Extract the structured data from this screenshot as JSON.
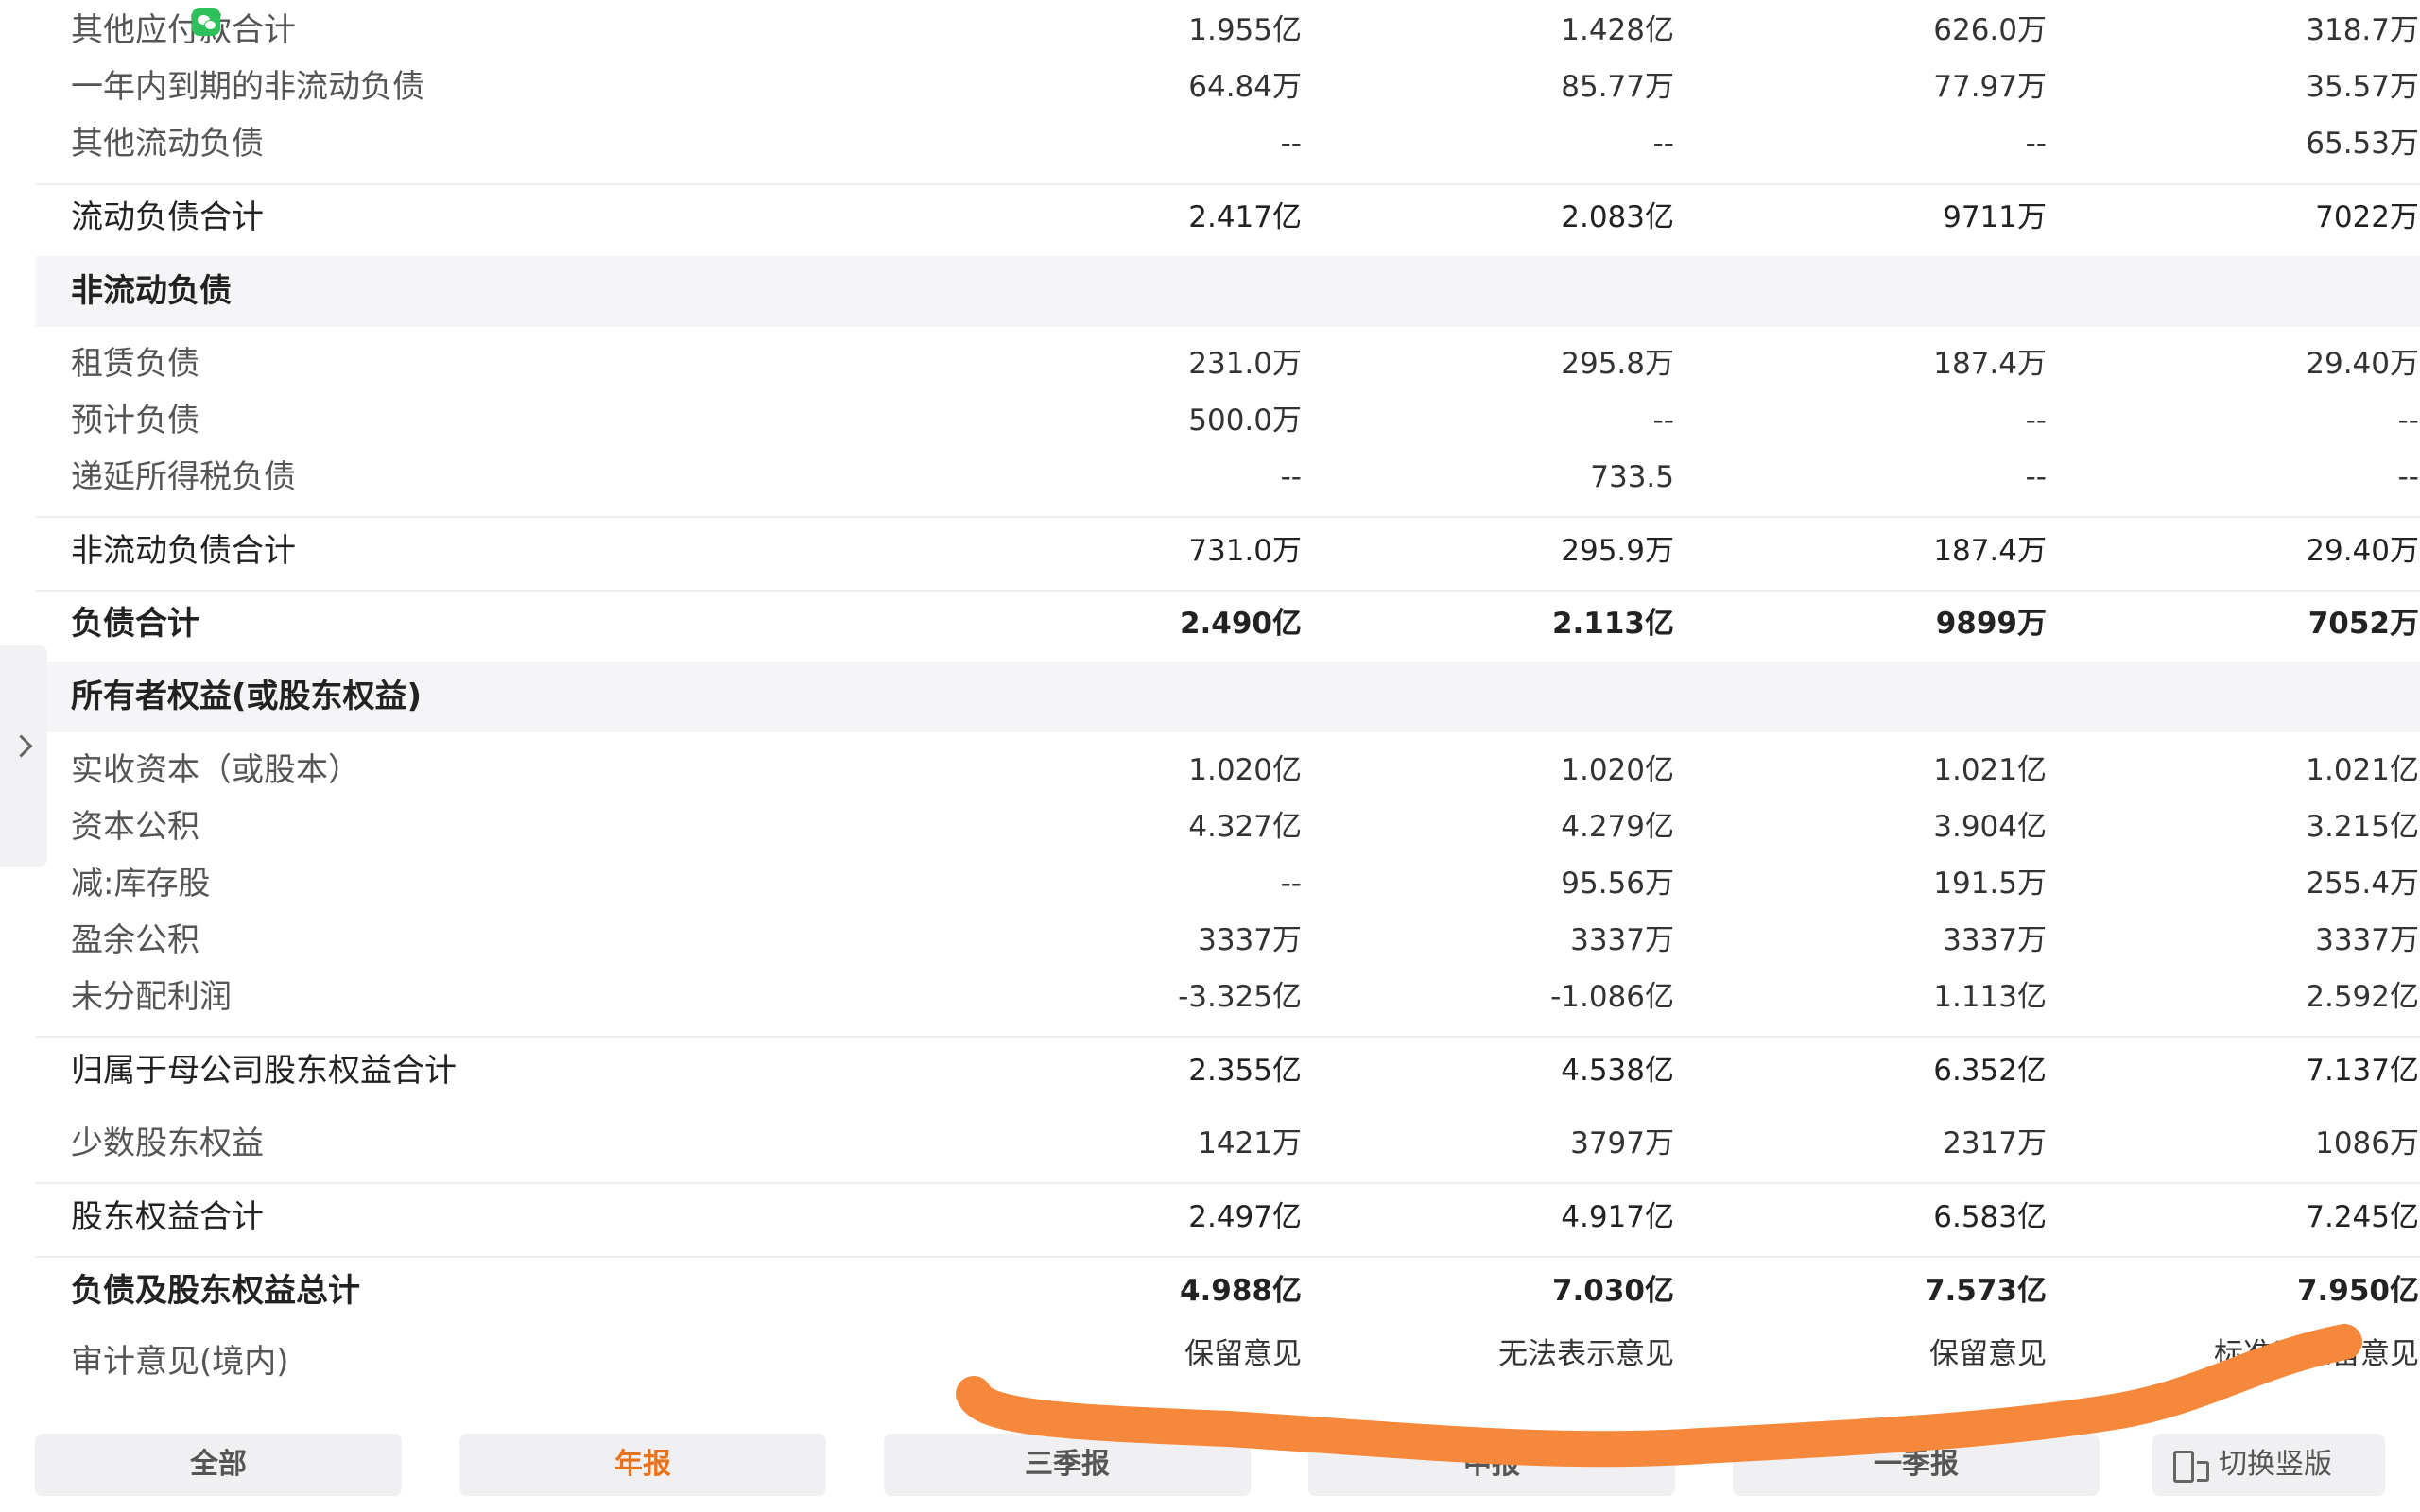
{
  "rows": {
    "other_payables": {
      "label": "其他应付款合计",
      "v": [
        "1.955亿",
        "1.428亿",
        "626.0万",
        "318.7万"
      ]
    },
    "noncurrent_due_1y": {
      "label": "一年内到期的非流动负债",
      "v": [
        "64.84万",
        "85.77万",
        "77.97万",
        "35.57万"
      ]
    },
    "other_current": {
      "label": "其他流动负债",
      "v": [
        "--",
        "--",
        "--",
        "65.53万"
      ]
    },
    "current_total": {
      "label": "流动负债合计",
      "v": [
        "2.417亿",
        "2.083亿",
        "9711万",
        "7022万"
      ]
    },
    "lease": {
      "label": "租赁负债",
      "v": [
        "231.0万",
        "295.8万",
        "187.4万",
        "29.40万"
      ]
    },
    "provisions": {
      "label": "预计负债",
      "v": [
        "500.0万",
        "--",
        "--",
        "--"
      ]
    },
    "deferred_tax": {
      "label": "递延所得税负债",
      "v": [
        "--",
        "733.5",
        "--",
        "--"
      ]
    },
    "noncurrent_total": {
      "label": "非流动负债合计",
      "v": [
        "731.0万",
        "295.9万",
        "187.4万",
        "29.40万"
      ]
    },
    "liab_total": {
      "label": "负债合计",
      "v": [
        "2.490亿",
        "2.113亿",
        "9899万",
        "7052万"
      ]
    },
    "paid_in": {
      "label": "实收资本（或股本）",
      "v": [
        "1.020亿",
        "1.020亿",
        "1.021亿",
        "1.021亿"
      ]
    },
    "cap_reserve": {
      "label": "资本公积",
      "v": [
        "4.327亿",
        "4.279亿",
        "3.904亿",
        "3.215亿"
      ]
    },
    "treasury": {
      "label": "减:库存股",
      "v": [
        "--",
        "95.56万",
        "191.5万",
        "255.4万"
      ]
    },
    "surplus": {
      "label": "盈余公积",
      "v": [
        "3337万",
        "3337万",
        "3337万",
        "3337万"
      ]
    },
    "retained": {
      "label": "未分配利润",
      "v": [
        "-3.325亿",
        "-1.086亿",
        "1.113亿",
        "2.592亿"
      ]
    },
    "parent_equity": {
      "label": "归属于母公司股东权益合计",
      "v": [
        "2.355亿",
        "4.538亿",
        "6.352亿",
        "7.137亿"
      ]
    },
    "minority": {
      "label": "少数股东权益",
      "v": [
        "1421万",
        "3797万",
        "2317万",
        "1086万"
      ]
    },
    "equity_total": {
      "label": "股东权益合计",
      "v": [
        "2.497亿",
        "4.917亿",
        "6.583亿",
        "7.245亿"
      ]
    },
    "grand_total": {
      "label": "负债及股东权益总计",
      "v": [
        "4.988亿",
        "7.030亿",
        "7.573亿",
        "7.950亿"
      ]
    },
    "audit": {
      "label": "审计意见(境内)",
      "v": [
        "保留意见",
        "无法表示意见",
        "保留意见",
        "标准无保留意见"
      ]
    }
  },
  "sections": {
    "noncurrent": "非流动负债",
    "equity": "所有者权益(或股东权益)"
  },
  "tabs": [
    "全部",
    "年报",
    "三季报",
    "中报",
    "一季报"
  ],
  "active_tab": "年报",
  "switch_label": "切换竖版",
  "colors": {
    "accent": "#e8721c",
    "scribble": "#f5883a",
    "section_bg": "#f5f5f7"
  }
}
